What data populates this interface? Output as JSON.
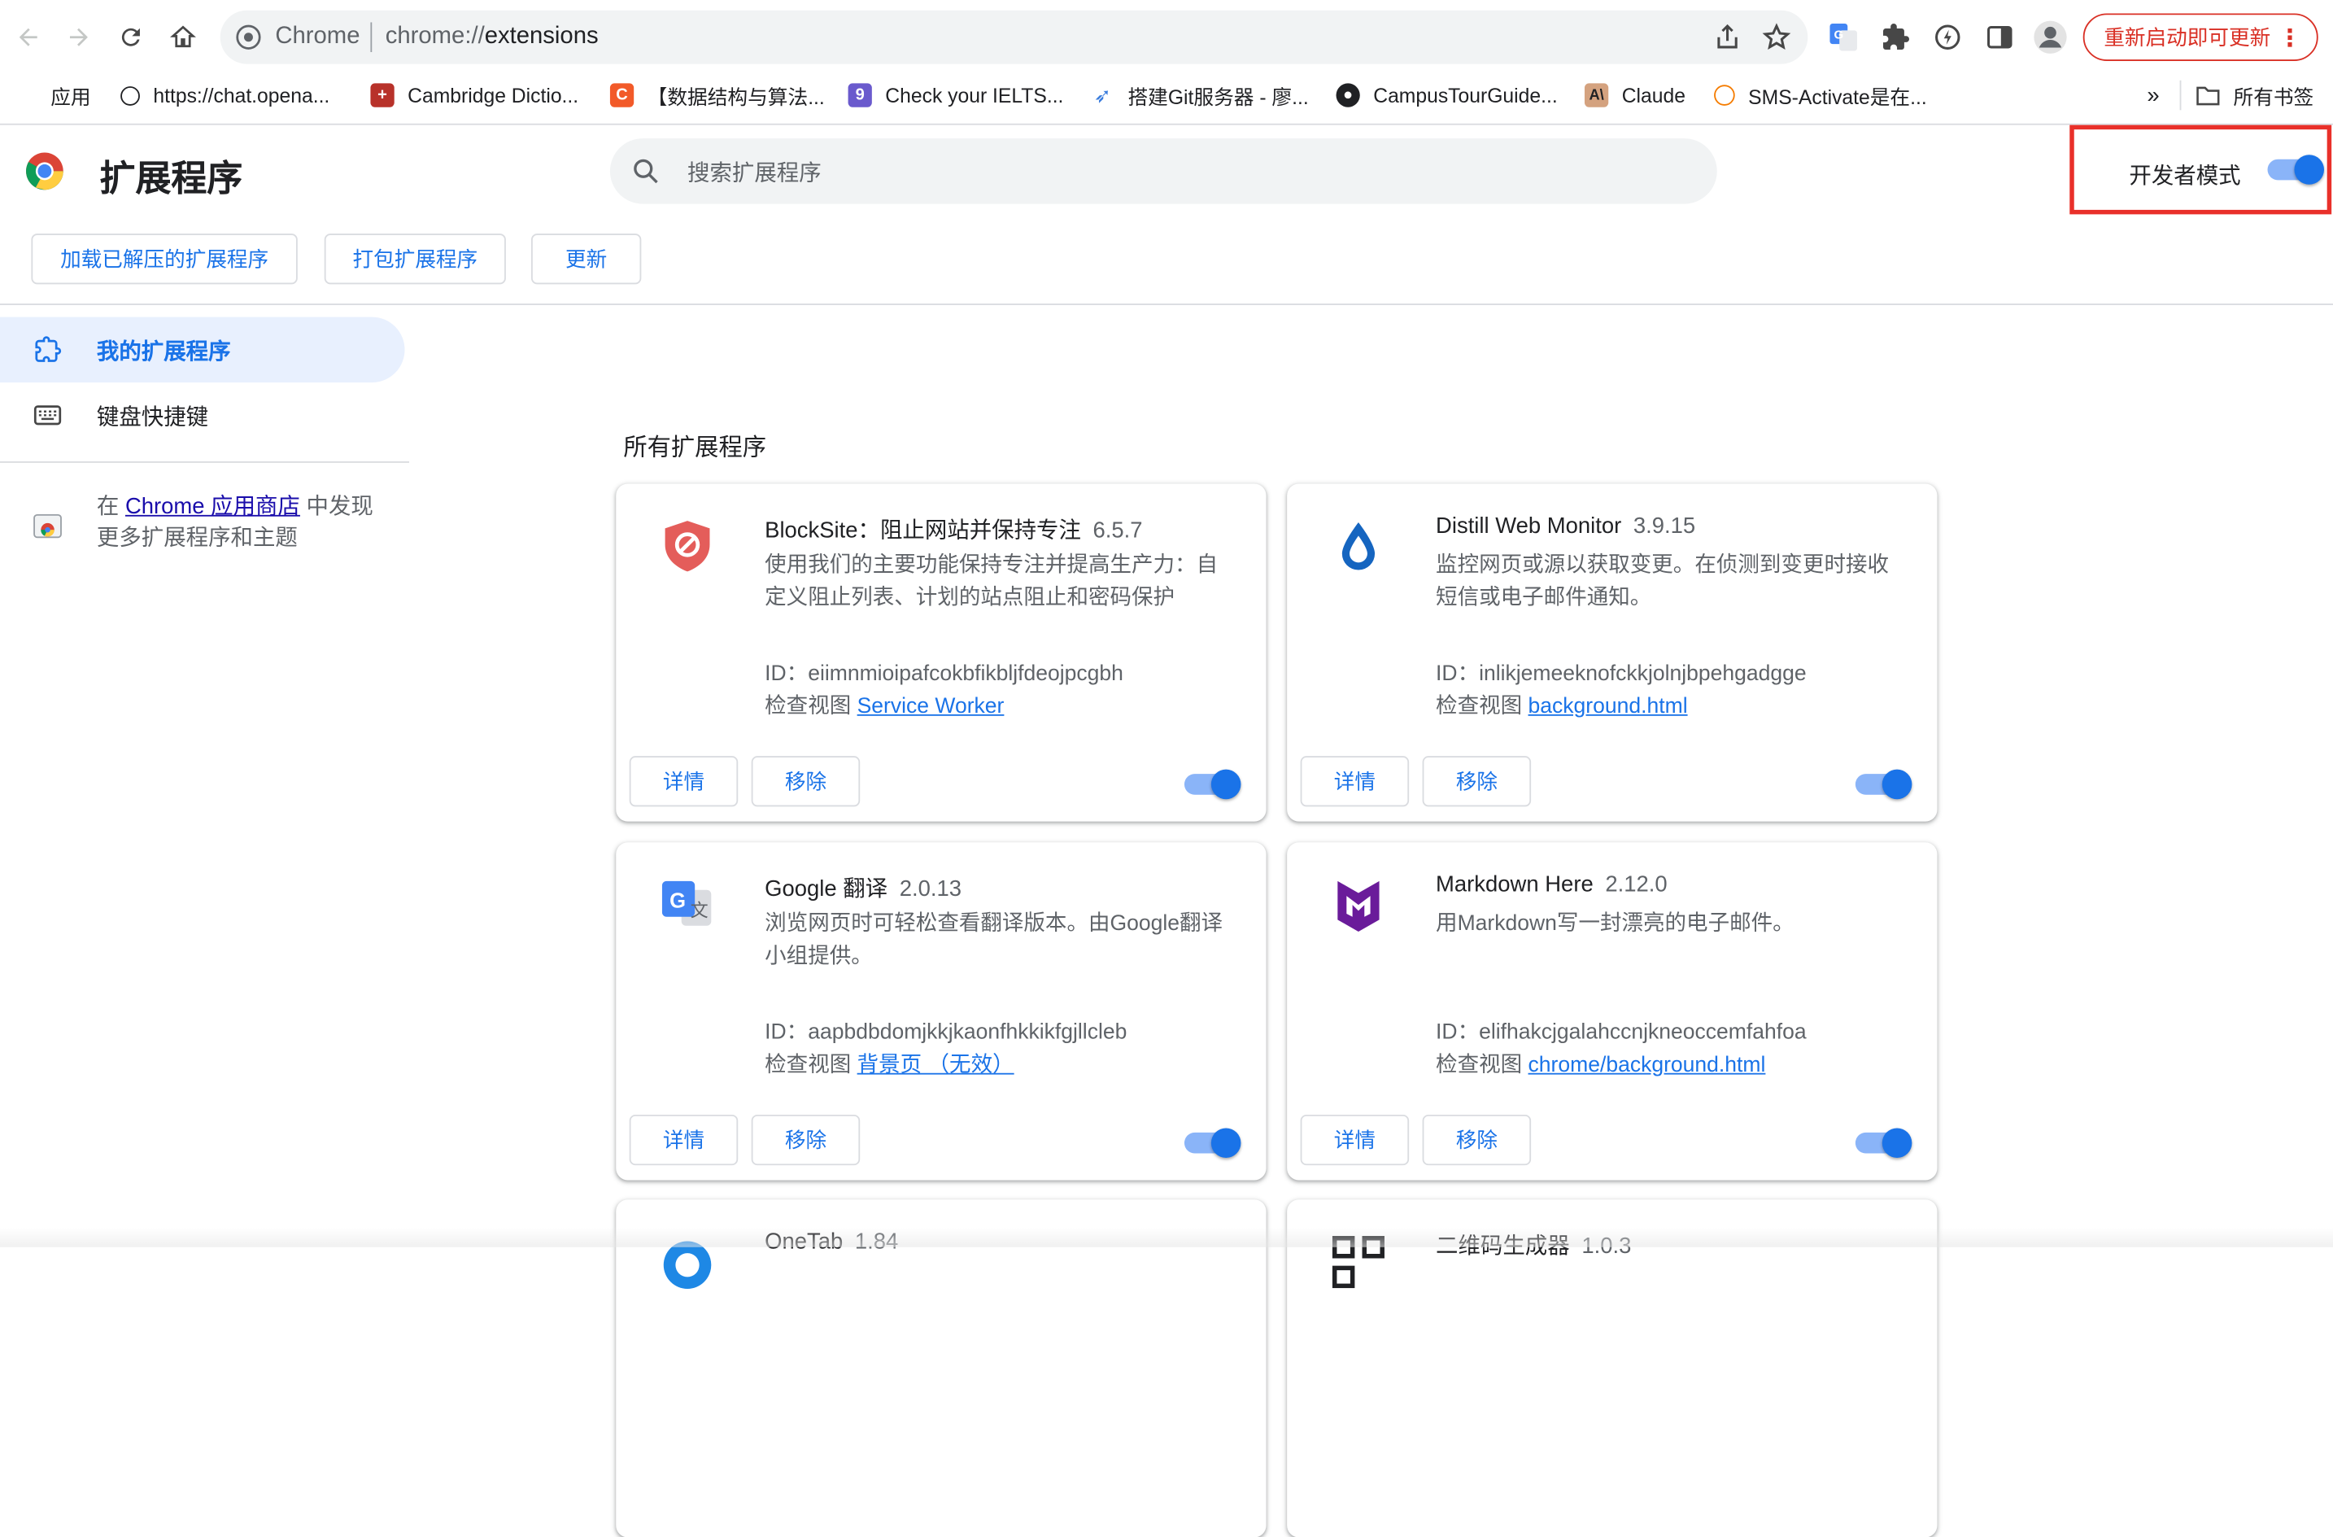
{
  "browser": {
    "site_name": "Chrome",
    "url_scheme": "chrome://",
    "url_path": "extensions",
    "update_label": "重新启动即可更新"
  },
  "bookmarks": [
    {
      "label": "应用",
      "icon": "apps-grid-icon"
    },
    {
      "label": "https://chat.opena...",
      "icon": "openai-icon"
    },
    {
      "label": "Cambridge Dictio...",
      "icon": "cambridge-icon"
    },
    {
      "label": "【数据结构与算法...",
      "icon": "c-icon"
    },
    {
      "label": "Check your IELTS...",
      "icon": "nine-icon"
    },
    {
      "label": "搭建Git服务器 - 廖...",
      "icon": "rocket-icon"
    },
    {
      "label": "CampusTourGuide...",
      "icon": "github-icon"
    },
    {
      "label": "Claude",
      "icon": "anthropic-icon"
    },
    {
      "label": "SMS-Activate是在...",
      "icon": "sms-icon"
    },
    {
      "label": "所有书签",
      "icon": "folder-icon"
    }
  ],
  "header": {
    "title": "扩展程序",
    "search_placeholder": "搜索扩展程序",
    "dev_mode_label": "开发者模式",
    "dev_mode_on": true
  },
  "actions": {
    "load_unpacked": "加载已解压的扩展程序",
    "pack": "打包扩展程序",
    "update": "更新"
  },
  "sidebar": {
    "items": [
      {
        "label": "我的扩展程序",
        "icon": "extension-icon",
        "active": true
      },
      {
        "label": "键盘快捷键",
        "icon": "keyboard-icon",
        "active": false
      }
    ],
    "store_prefix": "在 ",
    "store_link": "Chrome 应用商店",
    "store_suffix": " 中发现更多扩展程序和主题"
  },
  "section_title": "所有扩展程序",
  "labels": {
    "details": "详情",
    "remove": "移除",
    "id_prefix": "ID：",
    "inspect_prefix": "检查视图 "
  },
  "extensions": [
    {
      "name": "BlockSite：阻止网站并保持专注",
      "version": "6.5.7",
      "description": "使用我们的主要功能保持专注并提高生产力：自定义阻止列表、计划的站点阻止和密码保护",
      "id": "eiimnmioipafcokbfikbljfdeojpcgbh",
      "inspect_link": "Service Worker",
      "enabled": true,
      "icon": "blocksite-shield-icon"
    },
    {
      "name": "Distill Web Monitor",
      "version": "3.9.15",
      "description": "监控网页或源以获取变更。在侦测到变更时接收短信或电子邮件通知。",
      "id": "inlikjemeeknofckkjolnjbpehgadgge",
      "inspect_link": "background.html",
      "enabled": true,
      "icon": "distill-drop-icon"
    },
    {
      "name": "Google 翻译",
      "version": "2.0.13",
      "description": "浏览网页时可轻松查看翻译版本。由Google翻译小组提供。",
      "id": "aapbdbdomjkkjkaonfhkkikfgjllcleb",
      "inspect_link": "背景页 （无效）",
      "enabled": true,
      "icon": "google-translate-icon"
    },
    {
      "name": "Markdown Here",
      "version": "2.12.0",
      "description": "用Markdown写一封漂亮的电子邮件。",
      "id": "elifhakcjgalahccnjkneoccemfahfoa",
      "inspect_link": "chrome/background.html",
      "enabled": true,
      "icon": "markdown-here-icon"
    },
    {
      "name": "OneTab",
      "version": "1.84",
      "icon": "onetab-icon"
    },
    {
      "name": "二维码生成器",
      "version": "1.0.3",
      "icon": "qr-code-icon"
    }
  ]
}
